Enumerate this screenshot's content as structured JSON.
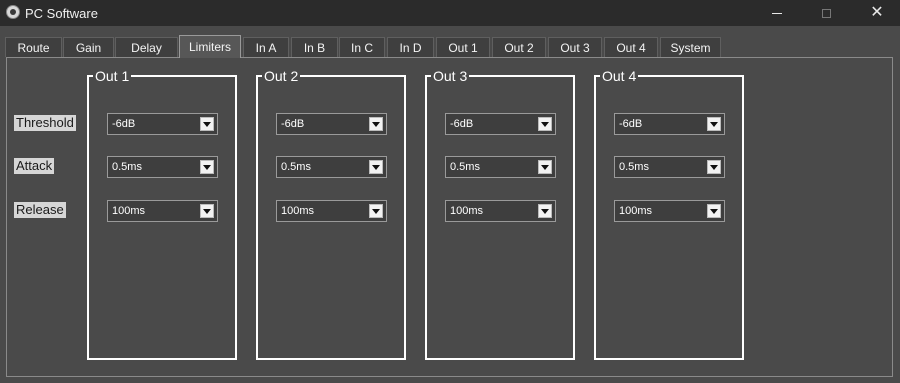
{
  "window": {
    "title": "PC Software"
  },
  "tabs": [
    {
      "label": "Route"
    },
    {
      "label": "Gain"
    },
    {
      "label": "Delay"
    },
    {
      "label": "Limiters"
    },
    {
      "label": "In A"
    },
    {
      "label": "In B"
    },
    {
      "label": "In C"
    },
    {
      "label": "In D"
    },
    {
      "label": "Out 1"
    },
    {
      "label": "Out 2"
    },
    {
      "label": "Out 3"
    },
    {
      "label": "Out 4"
    },
    {
      "label": "System"
    }
  ],
  "active_tab": "Limiters",
  "row_labels": {
    "threshold": "Threshold",
    "attack": "Attack",
    "release": "Release"
  },
  "outputs": [
    {
      "name": "Out 1",
      "threshold": "-6dB",
      "attack": "0.5ms",
      "release": "100ms"
    },
    {
      "name": "Out 2",
      "threshold": "-6dB",
      "attack": "0.5ms",
      "release": "100ms"
    },
    {
      "name": "Out 3",
      "threshold": "-6dB",
      "attack": "0.5ms",
      "release": "100ms"
    },
    {
      "name": "Out 4",
      "threshold": "-6dB",
      "attack": "0.5ms",
      "release": "100ms"
    }
  ]
}
